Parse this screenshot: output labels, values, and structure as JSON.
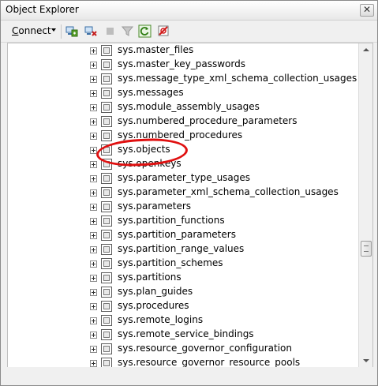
{
  "window": {
    "title": "Object Explorer",
    "close_glyph": "✕"
  },
  "toolbar": {
    "connect_label_underlined": "C",
    "connect_label_rest": "onnect",
    "icons": [
      "connect-object-explorer-icon",
      "disconnect-icon",
      "stop-icon",
      "filter-icon",
      "refresh-icon",
      "activity-monitor-icon"
    ]
  },
  "tree": {
    "items": [
      {
        "label": "sys.master_files"
      },
      {
        "label": "sys.master_key_passwords"
      },
      {
        "label": "sys.message_type_xml_schema_collection_usages"
      },
      {
        "label": "sys.messages"
      },
      {
        "label": "sys.module_assembly_usages"
      },
      {
        "label": "sys.numbered_procedure_parameters"
      },
      {
        "label": "sys.numbered_procedures"
      },
      {
        "label": "sys.objects"
      },
      {
        "label": "sys.openkeys"
      },
      {
        "label": "sys.parameter_type_usages"
      },
      {
        "label": "sys.parameter_xml_schema_collection_usages"
      },
      {
        "label": "sys.parameters"
      },
      {
        "label": "sys.partition_functions"
      },
      {
        "label": "sys.partition_parameters"
      },
      {
        "label": "sys.partition_range_values"
      },
      {
        "label": "sys.partition_schemes"
      },
      {
        "label": "sys.partitions"
      },
      {
        "label": "sys.plan_guides"
      },
      {
        "label": "sys.procedures"
      },
      {
        "label": "sys.remote_logins"
      },
      {
        "label": "sys.remote_service_bindings"
      },
      {
        "label": "sys.resource_governor_configuration"
      },
      {
        "label": "sys.resource_governor_resource_pools"
      }
    ],
    "highlighted_item": "sys.objects",
    "highlight_color": "#e01010"
  },
  "colors": {
    "tree_background": "#ffffff",
    "chrome_background": "#f0f0f0"
  }
}
